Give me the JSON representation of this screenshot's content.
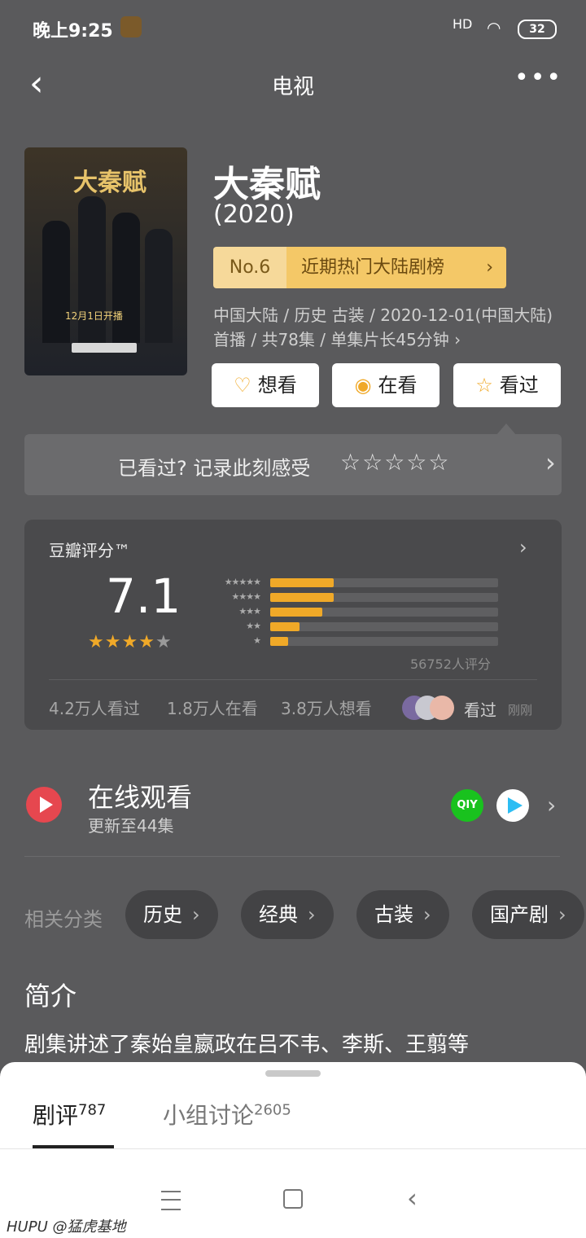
{
  "status_bar": {
    "time": "晚上9:25",
    "signal": "HD",
    "battery": "32"
  },
  "nav": {
    "back_icon": "chevron-left-icon",
    "title": "电视",
    "more_icon": "more-icon"
  },
  "poster": {
    "title": "大秦赋",
    "date_text": "12月1日开播"
  },
  "movie": {
    "title": "大秦赋",
    "year": "(2020)",
    "rank_no": "No.6",
    "rank_list": "近期热门大陆剧榜",
    "meta": "中国大陆 / 历史 古装 / 2020-12-01(中国大陆)首播 / 共78集 / 单集片长45分钟"
  },
  "actions": [
    {
      "label": "想看",
      "icon": "heart-plus-icon"
    },
    {
      "label": "在看",
      "icon": "target-icon"
    },
    {
      "label": "看过",
      "icon": "star-outline-icon"
    }
  ],
  "rate_prompt": {
    "text": "已看过? 记录此刻感受",
    "stars": "☆☆☆☆☆"
  },
  "rating": {
    "label": "豆瓣评分™",
    "score": "7.1",
    "stars_rating": 3.5,
    "distribution": [
      {
        "stars": "★★★★★",
        "percent": 28
      },
      {
        "stars": "★★★★",
        "percent": 28
      },
      {
        "stars": "★★★",
        "percent": 23
      },
      {
        "stars": "★★",
        "percent": 13
      },
      {
        "stars": "★",
        "percent": 8
      }
    ],
    "count": "56752人评分",
    "watched": "4.2万人看过",
    "watching": "1.8万人在看",
    "want": "3.8万人想看",
    "friend_status": "看过",
    "friend_time": "刚刚"
  },
  "online": {
    "title": "在线观看",
    "subtitle": "更新至44集",
    "iqiyi": "QIY",
    "platforms": [
      "iqiyi-icon",
      "tencent-video-icon"
    ]
  },
  "tags": {
    "label": "相关分类",
    "items": [
      "历史",
      "经典",
      "古装",
      "国产剧"
    ]
  },
  "intro": {
    "heading": "简介",
    "text": "剧集讲述了秦始皇嬴政在吕不韦、李斯、王翦等"
  },
  "sheet": {
    "tab_reviews": "剧评",
    "reviews_count": "787",
    "tab_groups": "小组讨论",
    "groups_count": "2605"
  },
  "watermark": "HUPU @猛虎基地",
  "colors": {
    "accent": "#f0a928",
    "rank_bg": "#f4c867",
    "play": "#e6474f",
    "iqiyi": "#19c21e",
    "background": "#5a5a5c"
  }
}
